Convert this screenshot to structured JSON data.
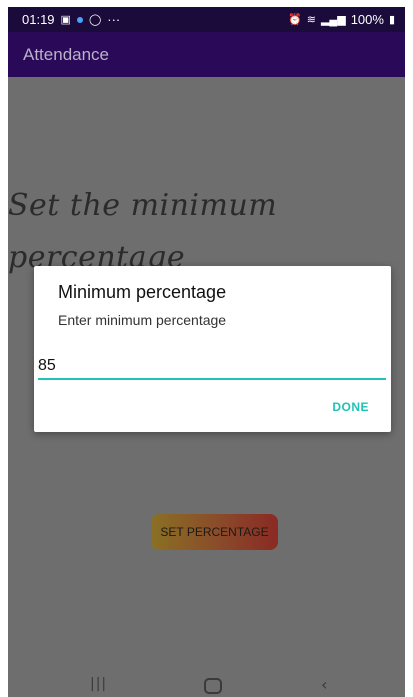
{
  "status_bar": {
    "time": "01:19",
    "more": "···",
    "battery": "100%",
    "icons": [
      "gallery-icon",
      "dot-icon",
      "whatsapp-icon",
      "alarm-icon",
      "wifi-icon",
      "volte-icon",
      "signal-icon",
      "battery-icon"
    ]
  },
  "app_bar": {
    "title": "Attendance"
  },
  "content": {
    "heading": "Set the minimum percentage",
    "set_button_label": "SET PERCENTAGE"
  },
  "dialog": {
    "title": "Minimum percentage",
    "message": "Enter minimum percentage",
    "input_value": "85",
    "done_label": "DONE"
  },
  "colors": {
    "status_bar": "#1a0b3b",
    "app_bar": "#2a0a58",
    "scrim": "#6e6e6e",
    "accent": "#1fc3b5"
  }
}
